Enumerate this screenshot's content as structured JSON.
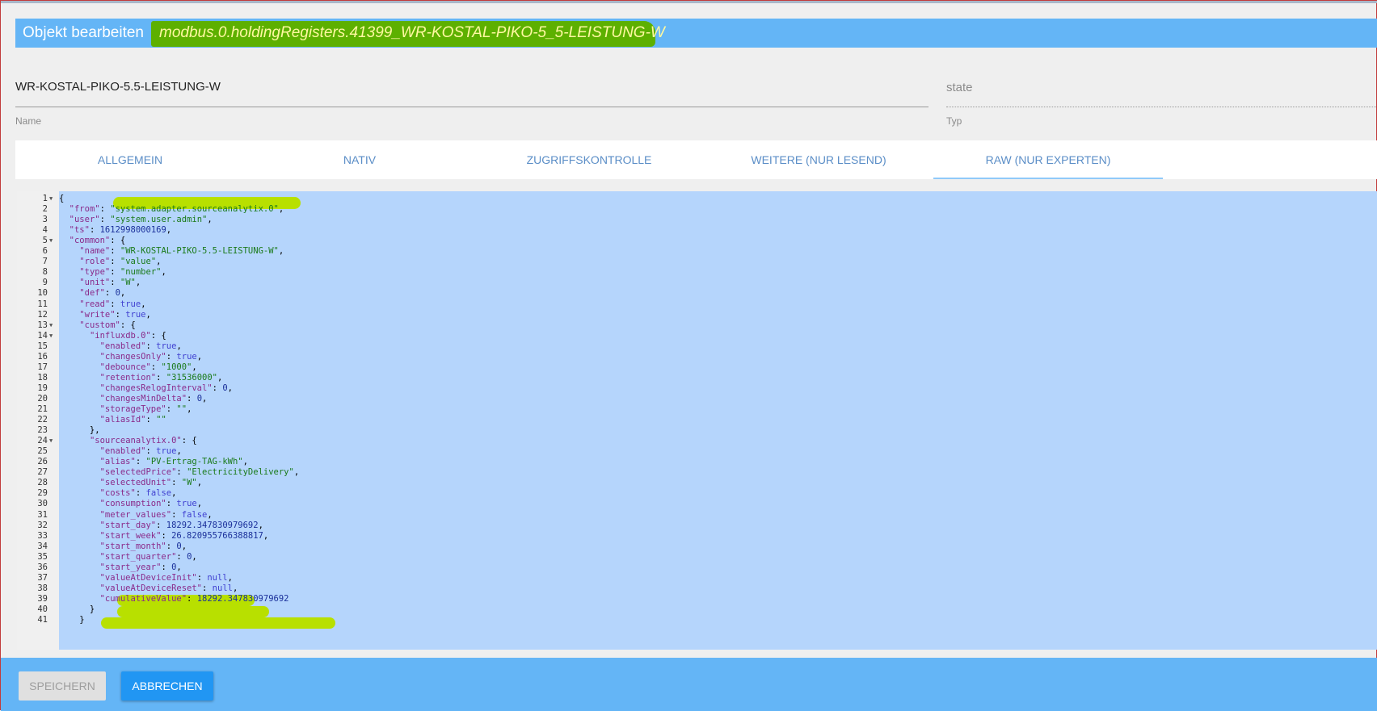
{
  "dialog": {
    "title_prefix": "Objekt bearbeiten",
    "object_id": "modbus.0.holdingRegisters.41399_WR-KOSTAL-PIKO-5_5-LEISTUNG-W"
  },
  "fields": {
    "name_value": "WR-KOSTAL-PIKO-5.5-LEISTUNG-W",
    "name_label": "Name",
    "type_value": "state",
    "type_label": "Typ"
  },
  "tabs": [
    {
      "label": "ALLGEMEIN"
    },
    {
      "label": "NATIV"
    },
    {
      "label": "ZUGRIFFSKONTROLLE"
    },
    {
      "label": "WEITERE (NUR LESEND)"
    },
    {
      "label": "RAW (NUR EXPERTEN)"
    }
  ],
  "active_tab": "RAW (NUR EXPERTEN)",
  "colors": {
    "accent": "#64b5f6",
    "primary_button": "#2196f3",
    "highlight": "#b8e000",
    "selection": "#b5d5fc"
  },
  "editor": {
    "lines": [
      {
        "n": "1",
        "fold": true,
        "c": "{"
      },
      {
        "n": "2",
        "c": "  \"from\": \"system.adapter.sourceanalytix.0\","
      },
      {
        "n": "3",
        "c": "  \"user\": \"system.user.admin\","
      },
      {
        "n": "4",
        "c": "  \"ts\": 1612998000169,"
      },
      {
        "n": "5",
        "fold": true,
        "c": "  \"common\": {"
      },
      {
        "n": "6",
        "c": "    \"name\": \"WR-KOSTAL-PIKO-5.5-LEISTUNG-W\","
      },
      {
        "n": "7",
        "c": "    \"role\": \"value\","
      },
      {
        "n": "8",
        "c": "    \"type\": \"number\","
      },
      {
        "n": "9",
        "c": "    \"unit\": \"W\","
      },
      {
        "n": "10",
        "c": "    \"def\": 0,"
      },
      {
        "n": "11",
        "c": "    \"read\": true,"
      },
      {
        "n": "12",
        "c": "    \"write\": true,"
      },
      {
        "n": "13",
        "fold": true,
        "c": "    \"custom\": {"
      },
      {
        "n": "14",
        "fold": true,
        "c": "      \"influxdb.0\": {"
      },
      {
        "n": "15",
        "c": "        \"enabled\": true,"
      },
      {
        "n": "16",
        "c": "        \"changesOnly\": true,"
      },
      {
        "n": "17",
        "c": "        \"debounce\": \"1000\","
      },
      {
        "n": "18",
        "c": "        \"retention\": \"31536000\","
      },
      {
        "n": "19",
        "c": "        \"changesRelogInterval\": 0,"
      },
      {
        "n": "20",
        "c": "        \"changesMinDelta\": 0,"
      },
      {
        "n": "21",
        "c": "        \"storageType\": \"\","
      },
      {
        "n": "22",
        "c": "        \"aliasId\": \"\""
      },
      {
        "n": "23",
        "c": "      },"
      },
      {
        "n": "24",
        "fold": true,
        "c": "      \"sourceanalytix.0\": {"
      },
      {
        "n": "25",
        "c": "        \"enabled\": true,"
      },
      {
        "n": "26",
        "c": "        \"alias\": \"PV-Ertrag-TAG-kWh\","
      },
      {
        "n": "27",
        "c": "        \"selectedPrice\": \"ElectricityDelivery\","
      },
      {
        "n": "28",
        "c": "        \"selectedUnit\": \"W\","
      },
      {
        "n": "29",
        "c": "        \"costs\": false,"
      },
      {
        "n": "30",
        "c": "        \"consumption\": true,"
      },
      {
        "n": "31",
        "c": "        \"meter_values\": false,"
      },
      {
        "n": "32",
        "c": "        \"start_day\": 18292.347830979692,"
      },
      {
        "n": "33",
        "c": "        \"start_week\": 26.820955766388817,"
      },
      {
        "n": "34",
        "c": "        \"start_month\": 0,"
      },
      {
        "n": "35",
        "c": "        \"start_quarter\": 0,"
      },
      {
        "n": "36",
        "c": "        \"start_year\": 0,"
      },
      {
        "n": "37",
        "c": "        \"valueAtDeviceInit\": null,"
      },
      {
        "n": "38",
        "c": "        \"valueAtDeviceReset\": null,"
      },
      {
        "n": "39",
        "c": "        \"cumulativeValue\": 18292.347830979692"
      },
      {
        "n": "40",
        "c": "      }"
      },
      {
        "n": "41",
        "c": "    }"
      }
    ],
    "highlighted_lines": [
      "2",
      "37",
      "38",
      "39"
    ]
  },
  "footer": {
    "save_label": "SPEICHERN",
    "cancel_label": "ABBRECHEN"
  }
}
